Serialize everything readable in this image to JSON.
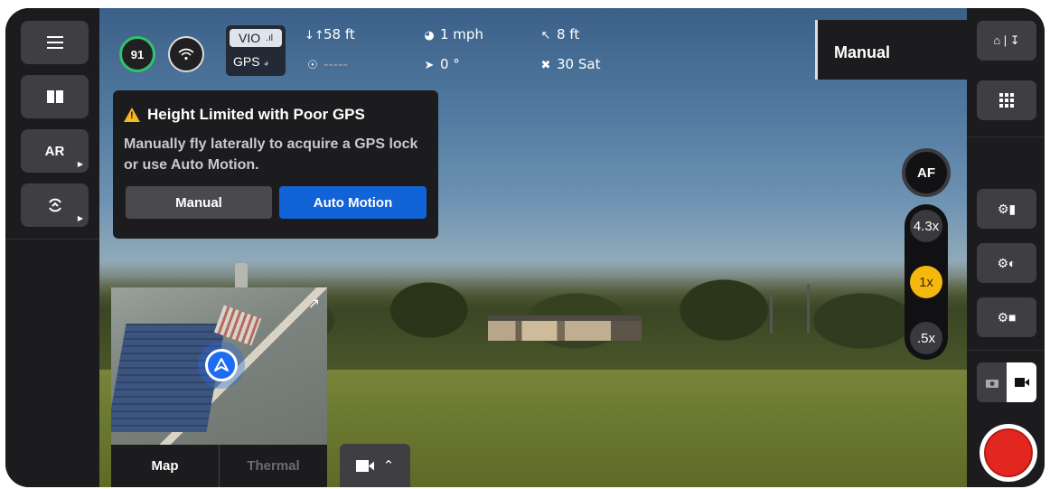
{
  "telemetry": {
    "battery": "91",
    "vio_label": "VIO",
    "gps_label": "GPS",
    "altitude": "58 ft",
    "speed": "1 mph",
    "distance": "8 ft",
    "heading": "-----",
    "gimbal": "0 °",
    "satellites": "30 Sat"
  },
  "flight_mode": "Manual",
  "left_bar": {
    "ar_label": "AR"
  },
  "warning": {
    "title": "Height Limited with Poor GPS",
    "body": "Manually fly laterally to acquire a GPS lock or use Auto Motion.",
    "manual_button": "Manual",
    "auto_button": "Auto Motion"
  },
  "camera": {
    "af_label": "AF",
    "zoom_levels": [
      "4.3x",
      "1x",
      ".5x"
    ],
    "active_zoom": "1x"
  },
  "map": {
    "tabs": [
      "Map",
      "Thermal"
    ],
    "active_tab": "Map"
  },
  "colors": {
    "accent_blue": "#1262d8",
    "battery_green": "#2fc46a",
    "zoom_active": "#f5b80f",
    "record_red": "#e1271f",
    "warning_yellow": "#f6b924"
  },
  "icons": {
    "menu": "hamburger-icon",
    "split": "split-view-icon",
    "gimbal": "gimbal-icon",
    "home": "home-icon",
    "grid": "grid-icon",
    "settings": "drone-settings-icon",
    "wifi": "wifi-icon",
    "video": "video-camera-icon",
    "photo": "photo-camera-icon"
  }
}
